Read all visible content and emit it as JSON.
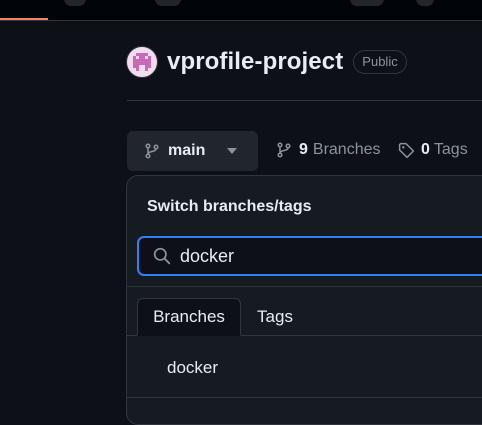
{
  "repo": {
    "name": "vprofile-project",
    "visibility": "Public"
  },
  "branch_selector": {
    "current_branch": "main"
  },
  "stats": {
    "branches_count": "9",
    "branches_label": "Branches",
    "tags_count": "0",
    "tags_label": "Tags"
  },
  "dropdown": {
    "title": "Switch branches/tags",
    "search_value": "docker",
    "tabs": [
      {
        "label": "Branches",
        "active": true
      },
      {
        "label": "Tags",
        "active": false
      }
    ],
    "results": [
      "docker"
    ]
  },
  "colors": {
    "background": "#0d1117",
    "accent": "#2f81f7",
    "nav_underline": "#f78166"
  }
}
